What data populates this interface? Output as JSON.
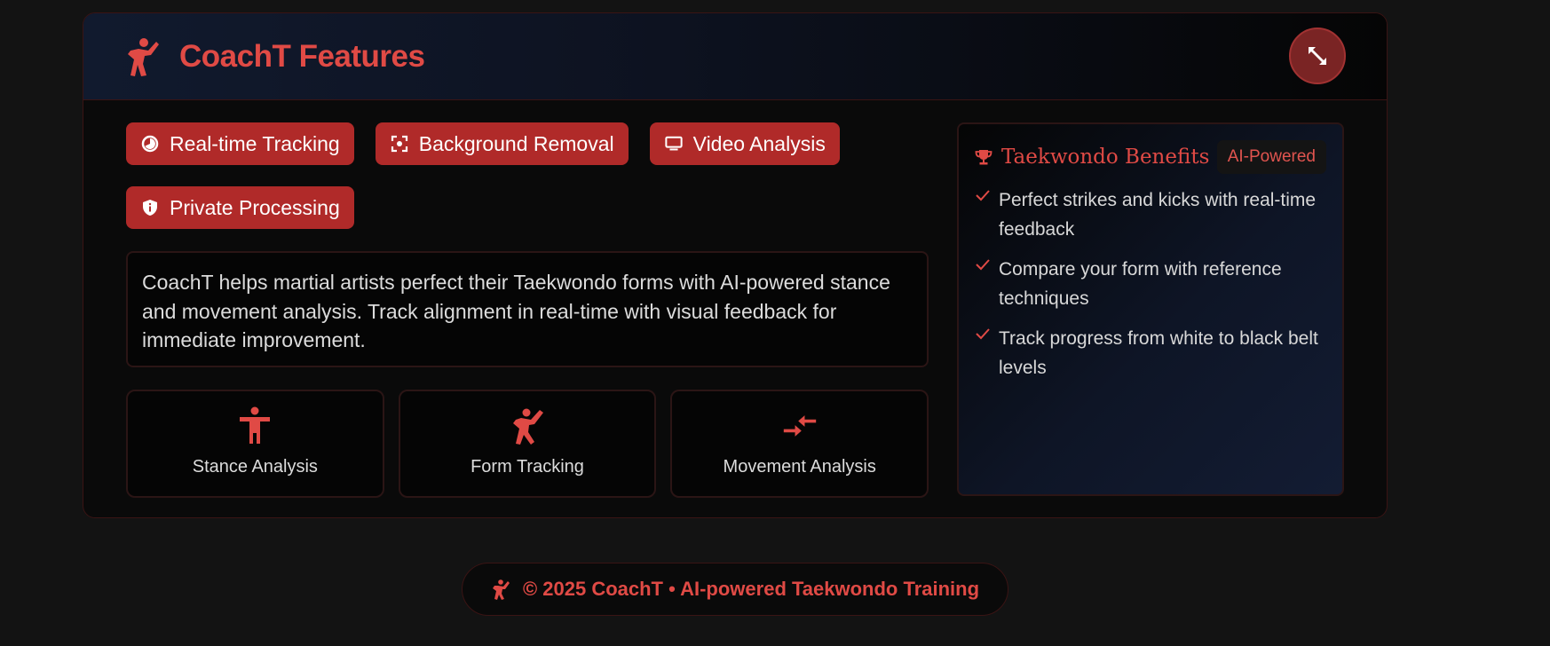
{
  "header": {
    "title": "CoachT Features",
    "logo_icon": "martial-arts-kick-icon",
    "expand_icon": "expand-diagonal-icon"
  },
  "chips": [
    {
      "label": "Real-time Tracking",
      "icon": "pie-chart-icon"
    },
    {
      "label": "Background Removal",
      "icon": "focus-frame-icon"
    },
    {
      "label": "Video Analysis",
      "icon": "monitor-icon"
    },
    {
      "label": "Private Processing",
      "icon": "shield-info-icon"
    }
  ],
  "description": "CoachT helps martial artists perfect their Taekwondo forms with AI-powered stance and movement analysis. Track alignment in real-time with visual feedback for immediate improvement.",
  "features": [
    {
      "label": "Stance Analysis",
      "icon": "standing-person-icon"
    },
    {
      "label": "Form Tracking",
      "icon": "martial-arts-kick-icon"
    },
    {
      "label": "Movement Analysis",
      "icon": "compare-arrows-icon"
    }
  ],
  "benefits": {
    "title": "Taekwondo Benefits",
    "badge": "AI-Powered",
    "items": [
      "Perfect strikes and kicks with real-time feedback",
      "Compare your form with reference techniques",
      "Track progress from white to black belt levels"
    ]
  },
  "footer": {
    "text": "© 2025 CoachT • AI-powered Taekwondo Training"
  },
  "colors": {
    "accent": "#e04a45",
    "chip_bg": "#b02a29",
    "background": "#131313"
  }
}
